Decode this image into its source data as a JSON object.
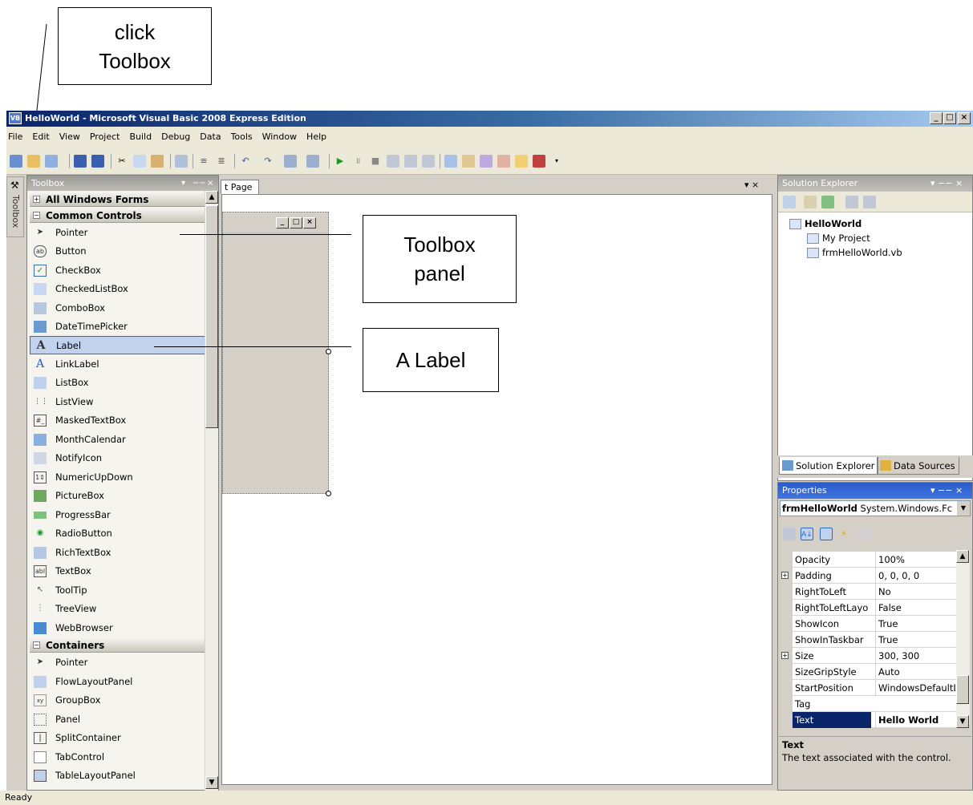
{
  "callouts": {
    "toolbox_tip": [
      "click",
      "Toolbox"
    ],
    "panel_tip": [
      "Toolbox",
      "panel"
    ],
    "label_tip": "A Label"
  },
  "window": {
    "title": "HelloWorld - Microsoft Visual Basic 2008 Express Edition",
    "app_icon": "VB",
    "controls": [
      "_",
      "□",
      "×"
    ]
  },
  "menu": [
    "File",
    "Edit",
    "View",
    "Project",
    "Build",
    "Debug",
    "Data",
    "Tools",
    "Window",
    "Help"
  ],
  "toolbar_icons": [
    "new-project-icon",
    "open-icon",
    "add-item-icon",
    "save-icon",
    "save-all-icon",
    "cut-icon",
    "copy-icon",
    "paste-icon",
    "find-icon",
    "comment-icon",
    "uncomment-icon",
    "undo-icon",
    "redo-icon",
    "navigate-back-icon",
    "navigate-forward-icon",
    "start-icon",
    "pause-icon",
    "stop-icon",
    "step-into-icon",
    "step-over-icon",
    "step-out-icon",
    "solution-explorer-icon",
    "properties-icon",
    "object-browser-icon",
    "toolbox-icon",
    "error-list-icon",
    "options-icon"
  ],
  "sidetab": {
    "label": "Toolbox"
  },
  "toolbox": {
    "title": "Toolbox",
    "header_controls": [
      "▾",
      "−−",
      "×"
    ],
    "groups": [
      {
        "label": "All Windows Forms",
        "expanded": false
      },
      {
        "label": "Common Controls",
        "expanded": true
      },
      {
        "label": "Containers",
        "expanded": true
      }
    ],
    "common_controls": [
      "Pointer",
      "Button",
      "CheckBox",
      "CheckedListBox",
      "ComboBox",
      "DateTimePicker",
      "Label",
      "LinkLabel",
      "ListBox",
      "ListView",
      "MaskedTextBox",
      "MonthCalendar",
      "NotifyIcon",
      "NumericUpDown",
      "PictureBox",
      "ProgressBar",
      "RadioButton",
      "RichTextBox",
      "TextBox",
      "ToolTip",
      "TreeView",
      "WebBrowser"
    ],
    "containers": [
      "Pointer",
      "FlowLayoutPanel",
      "GroupBox",
      "Panel",
      "SplitContainer",
      "TabControl",
      "TableLayoutPanel"
    ],
    "selected": "Label"
  },
  "document": {
    "tab_label": "t Page",
    "close": "▾ ×",
    "form_controls": [
      "_",
      "□",
      "×"
    ]
  },
  "solution_explorer": {
    "title": "Solution Explorer",
    "header_controls": "▾ −− ×",
    "tree": [
      "HelloWorld",
      "My Project",
      "frmHelloWorld.vb"
    ],
    "tabs": [
      "Solution Explorer",
      "Data Sources"
    ]
  },
  "properties": {
    "title": "Properties",
    "header_controls": "▾ −− ×",
    "object_name": "frmHelloWorld",
    "object_type": "System.Windows.Fc",
    "rows": [
      {
        "name": "Opacity",
        "value": "100%",
        "expandable": false
      },
      {
        "name": "Padding",
        "value": "0, 0, 0, 0",
        "expandable": true
      },
      {
        "name": "RightToLeft",
        "value": "No",
        "expandable": false
      },
      {
        "name": "RightToLeftLayo",
        "value": "False",
        "expandable": false
      },
      {
        "name": "ShowIcon",
        "value": "True",
        "expandable": false
      },
      {
        "name": "ShowInTaskbar",
        "value": "True",
        "expandable": false
      },
      {
        "name": "Size",
        "value": "300, 300",
        "expandable": true
      },
      {
        "name": "SizeGripStyle",
        "value": "Auto",
        "expandable": false
      },
      {
        "name": "StartPosition",
        "value": "WindowsDefaultL",
        "expandable": false
      },
      {
        "name": "Tag",
        "value": "",
        "expandable": false
      },
      {
        "name": "Text",
        "value": "Hello World",
        "expandable": false,
        "selected": true
      }
    ],
    "desc_title": "Text",
    "desc_body": "The text associated with the control."
  },
  "status": "Ready",
  "colors": {
    "titlebar": "#0a246a",
    "selection": "#316ac5",
    "chrome": "#d4d0c8"
  }
}
